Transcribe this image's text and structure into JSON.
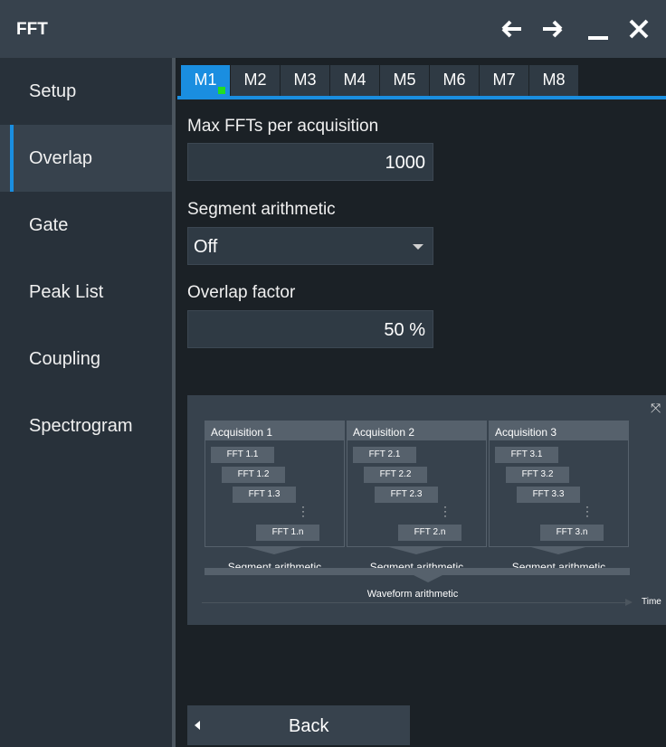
{
  "window": {
    "title": "FFT",
    "icons": [
      "arrow-left-icon",
      "arrow-right-icon",
      "minimize-icon",
      "close-icon"
    ]
  },
  "sidebar": {
    "items": [
      {
        "label": "Setup"
      },
      {
        "label": "Overlap",
        "active": true
      },
      {
        "label": "Gate"
      },
      {
        "label": "Peak List"
      },
      {
        "label": "Coupling"
      },
      {
        "label": "Spectrogram"
      }
    ]
  },
  "tabs": [
    {
      "label": "M1",
      "active": true
    },
    {
      "label": "M2"
    },
    {
      "label": "M3"
    },
    {
      "label": "M4"
    },
    {
      "label": "M5"
    },
    {
      "label": "M6"
    },
    {
      "label": "M7"
    },
    {
      "label": "M8"
    }
  ],
  "form": {
    "max_ffts_label": "Max FFTs per acquisition",
    "max_ffts_value": "1000",
    "segment_label": "Segment arithmetic",
    "segment_value": "Off",
    "overlap_label": "Overlap factor",
    "overlap_value": "50 %"
  },
  "diagram": {
    "acquisitions": [
      {
        "title": "Acquisition 1",
        "ffts": [
          "FFT 1.1",
          "FFT 1.2",
          "FFT 1.3",
          "FFT 1.n"
        ],
        "segment": "Segment arithmetic"
      },
      {
        "title": "Acquisition 2",
        "ffts": [
          "FFT 2.1",
          "FFT 2.2",
          "FFT 2.3",
          "FFT 2.n"
        ],
        "segment": "Segment arithmetic"
      },
      {
        "title": "Acquisition 3",
        "ffts": [
          "FFT 3.1",
          "FFT 3.2",
          "FFT 3.3",
          "FFT 3.n"
        ],
        "segment": "Segment arithmetic"
      }
    ],
    "waveform": "Waveform arithmetic",
    "time_label": "Time"
  },
  "footer": {
    "back_label": "Back"
  },
  "colors": {
    "accent": "#1a8ee0",
    "indicator": "#22dd22",
    "background": "#1b2126",
    "panel": "#37424d"
  }
}
